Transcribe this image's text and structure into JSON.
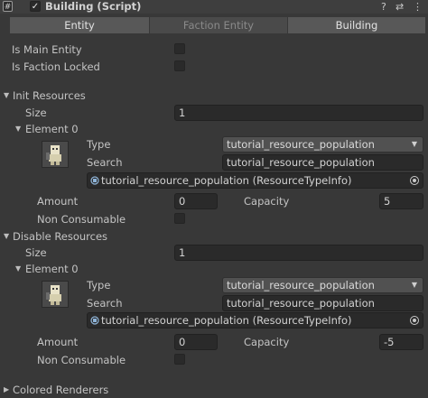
{
  "header": {
    "title": "Building (Script)",
    "checked": true,
    "icons": [
      "script-icon",
      "help-icon",
      "preset-icon",
      "kebab-menu-icon"
    ]
  },
  "tabs": [
    {
      "label": "Entity",
      "active": true
    },
    {
      "label": "Faction Entity",
      "active": false
    },
    {
      "label": "Building",
      "active": true
    }
  ],
  "fields": {
    "is_main_entity": "Is Main Entity",
    "is_faction_locked": "Is Faction Locked"
  },
  "init_resources": {
    "title": "Init Resources",
    "size_label": "Size",
    "size_value": "1",
    "element_label": "Element 0",
    "type_label": "Type",
    "type_value": "tutorial_resource_population",
    "search_label": "Search",
    "search_value": "tutorial_resource_population",
    "object_value": "tutorial_resource_population (ResourceTypeInfo)",
    "amount_label": "Amount",
    "amount_value": "0",
    "capacity_label": "Capacity",
    "capacity_value": "5",
    "non_consumable_label": "Non Consumable"
  },
  "disable_resources": {
    "title": "Disable Resources",
    "size_label": "Size",
    "size_value": "1",
    "element_label": "Element 0",
    "type_label": "Type",
    "type_value": "tutorial_resource_population",
    "search_label": "Search",
    "search_value": "tutorial_resource_population",
    "object_value": "tutorial_resource_population (ResourceTypeInfo)",
    "amount_label": "Amount",
    "amount_value": "0",
    "capacity_label": "Capacity",
    "capacity_value": "-5",
    "non_consumable_label": "Non Consumable"
  },
  "colored_renderers": {
    "title": "Colored Renderers"
  },
  "colors": {
    "bg": "#383838",
    "field": "#2a2a2a",
    "tab_active": "#585858"
  }
}
